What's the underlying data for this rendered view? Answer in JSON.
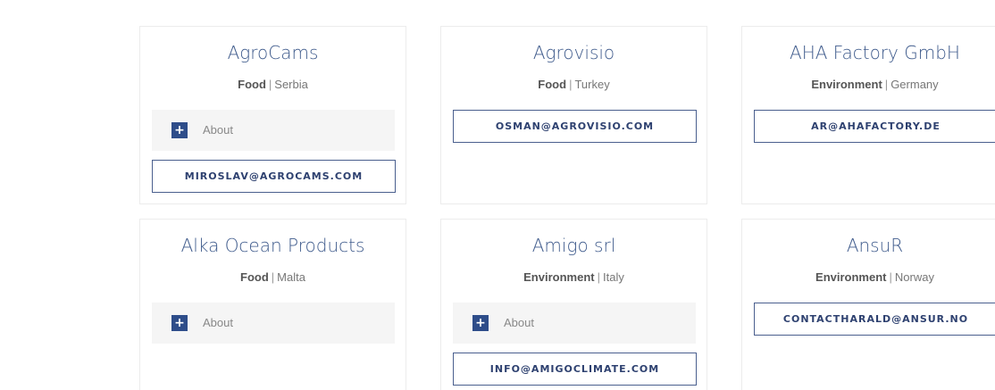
{
  "about_label": "About",
  "plus_symbol": "+",
  "separator": "|",
  "colors": {
    "title": "#3f5b8c",
    "accent": "#2e4d8a",
    "button_text": "#2e4170",
    "about_bg": "#f5f5f5"
  },
  "companies": [
    {
      "name": "AgroCams",
      "category": "Food",
      "country": "Serbia",
      "has_about": true,
      "email": "MIROSLAV@AGROCAMS.COM"
    },
    {
      "name": "Agrovisio",
      "category": "Food",
      "country": "Turkey",
      "has_about": false,
      "email": "OSMAN@AGROVISIO.COM"
    },
    {
      "name": "AHA Factory GmbH",
      "category": "Environment",
      "country": "Germany",
      "has_about": false,
      "email": "AR@AHAFACTORY.DE"
    },
    {
      "name": "Alka Ocean Products",
      "category": "Food",
      "country": "Malta",
      "has_about": true,
      "email": ""
    },
    {
      "name": "Amigo srl",
      "category": "Environment",
      "country": "Italy",
      "has_about": true,
      "email": "INFO@AMIGOCLIMATE.COM"
    },
    {
      "name": "AnsuR",
      "category": "Environment",
      "country": "Norway",
      "has_about": false,
      "email": "CONTACTHARALD@ANSUR.NO"
    }
  ]
}
